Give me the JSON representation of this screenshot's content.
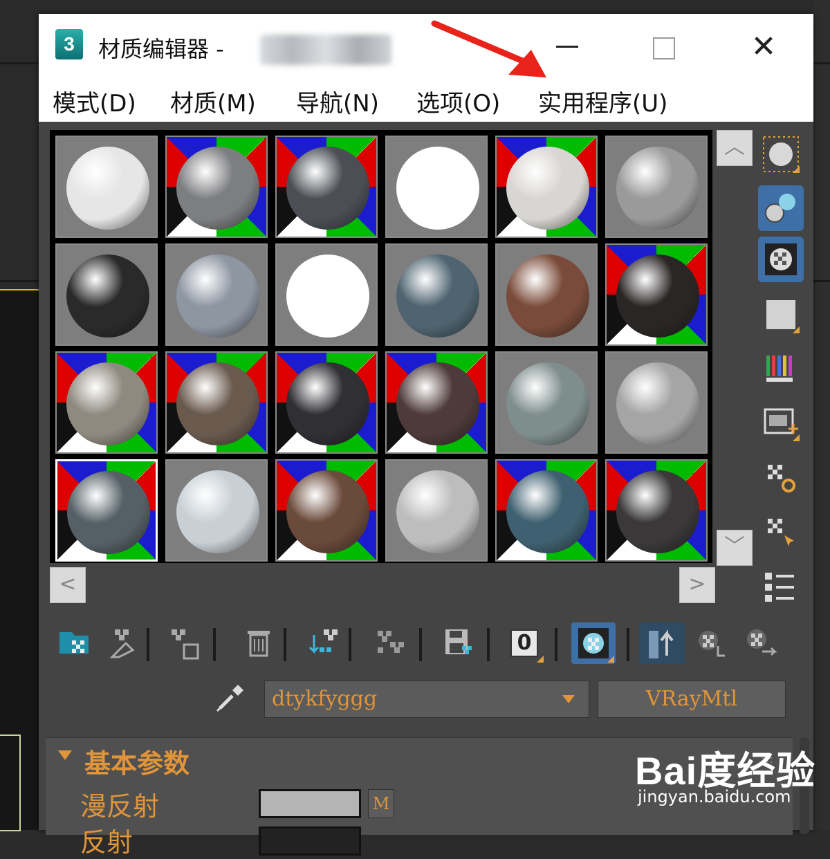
{
  "window": {
    "app_icon_label": "3",
    "title": "材质编辑器 -",
    "controls": {
      "minimize": "—",
      "maximize": "□",
      "close": "✕"
    }
  },
  "menu": {
    "items": [
      "模式(D)",
      "材质(M)",
      "导航(N)",
      "选项(O)",
      "实用程序(U)"
    ]
  },
  "slots": [
    {
      "color": "#e6e6e6",
      "checker": false
    },
    {
      "color": "#7d7e80",
      "checker": true
    },
    {
      "color": "#4b4f55",
      "checker": true
    },
    {
      "color": "#ffffff",
      "checker": false
    },
    {
      "color": "#d8d6d2",
      "checker": true
    },
    {
      "color": "#9a9a9a",
      "checker": false
    },
    {
      "color": "#2a2a2a",
      "checker": false
    },
    {
      "color": "#8e96a2",
      "checker": false
    },
    {
      "color": "#ffffff",
      "checker": false
    },
    {
      "color": "#4f6470",
      "checker": false
    },
    {
      "color": "#7a4b3a",
      "checker": false
    },
    {
      "color": "#2a2626",
      "checker": true
    },
    {
      "color": "#8f8a80",
      "checker": true
    },
    {
      "color": "#6a5a4e",
      "checker": true
    },
    {
      "color": "#2f2f34",
      "checker": true
    },
    {
      "color": "#4e3a3a",
      "checker": true
    },
    {
      "color": "#7e8e8c",
      "checker": false
    },
    {
      "color": "#a5a5a5",
      "checker": false
    },
    {
      "color": "#556066",
      "checker": true
    },
    {
      "color": "#c8d0d6",
      "checker": false
    },
    {
      "color": "#6a4a3a",
      "checker": true
    },
    {
      "color": "#bdbdbd",
      "checker": false
    },
    {
      "color": "#3f6070",
      "checker": true
    },
    {
      "color": "#3a3838",
      "checker": true
    }
  ],
  "selected_slot": 18,
  "scroll": {
    "up": "︿",
    "down": "﹀",
    "left": "<",
    "right": ">"
  },
  "side_tools": [
    "sample-type-icon",
    "backlight-icon",
    "background-checker-icon",
    "sample-uv-tiling-icon",
    "video-color-check-icon",
    "make-preview-icon",
    "options-icon",
    "select-by-material-icon",
    "material-map-navigator-icon"
  ],
  "bottom_tools": [
    "get-material-icon",
    "put-to-scene-icon",
    "assign-to-selection-icon",
    "reset-map-icon",
    "make-unique-icon",
    "copy-material-icon",
    "put-to-library-icon",
    "material-id-channel-icon",
    "show-shaded-in-viewport-icon",
    "show-end-result-icon",
    "go-to-parent-icon",
    "go-forward-to-sibling-icon"
  ],
  "material_id": "0",
  "name_field": {
    "value": "dtykfyggg"
  },
  "type_button": {
    "label": "VRayMtl"
  },
  "rollout": {
    "title": "基本参数",
    "diffuse_label": "漫反射",
    "diffuse_color": "#b4b4b4",
    "map_button": "M",
    "reflect_label": "反射"
  },
  "watermark": {
    "logo": "Bai度经验",
    "url": "jingyan.baidu.com"
  },
  "colors": {
    "accent_orange": "#e0953a",
    "active_blue": "#3e6fa6",
    "arrow_red": "#e8231a"
  }
}
